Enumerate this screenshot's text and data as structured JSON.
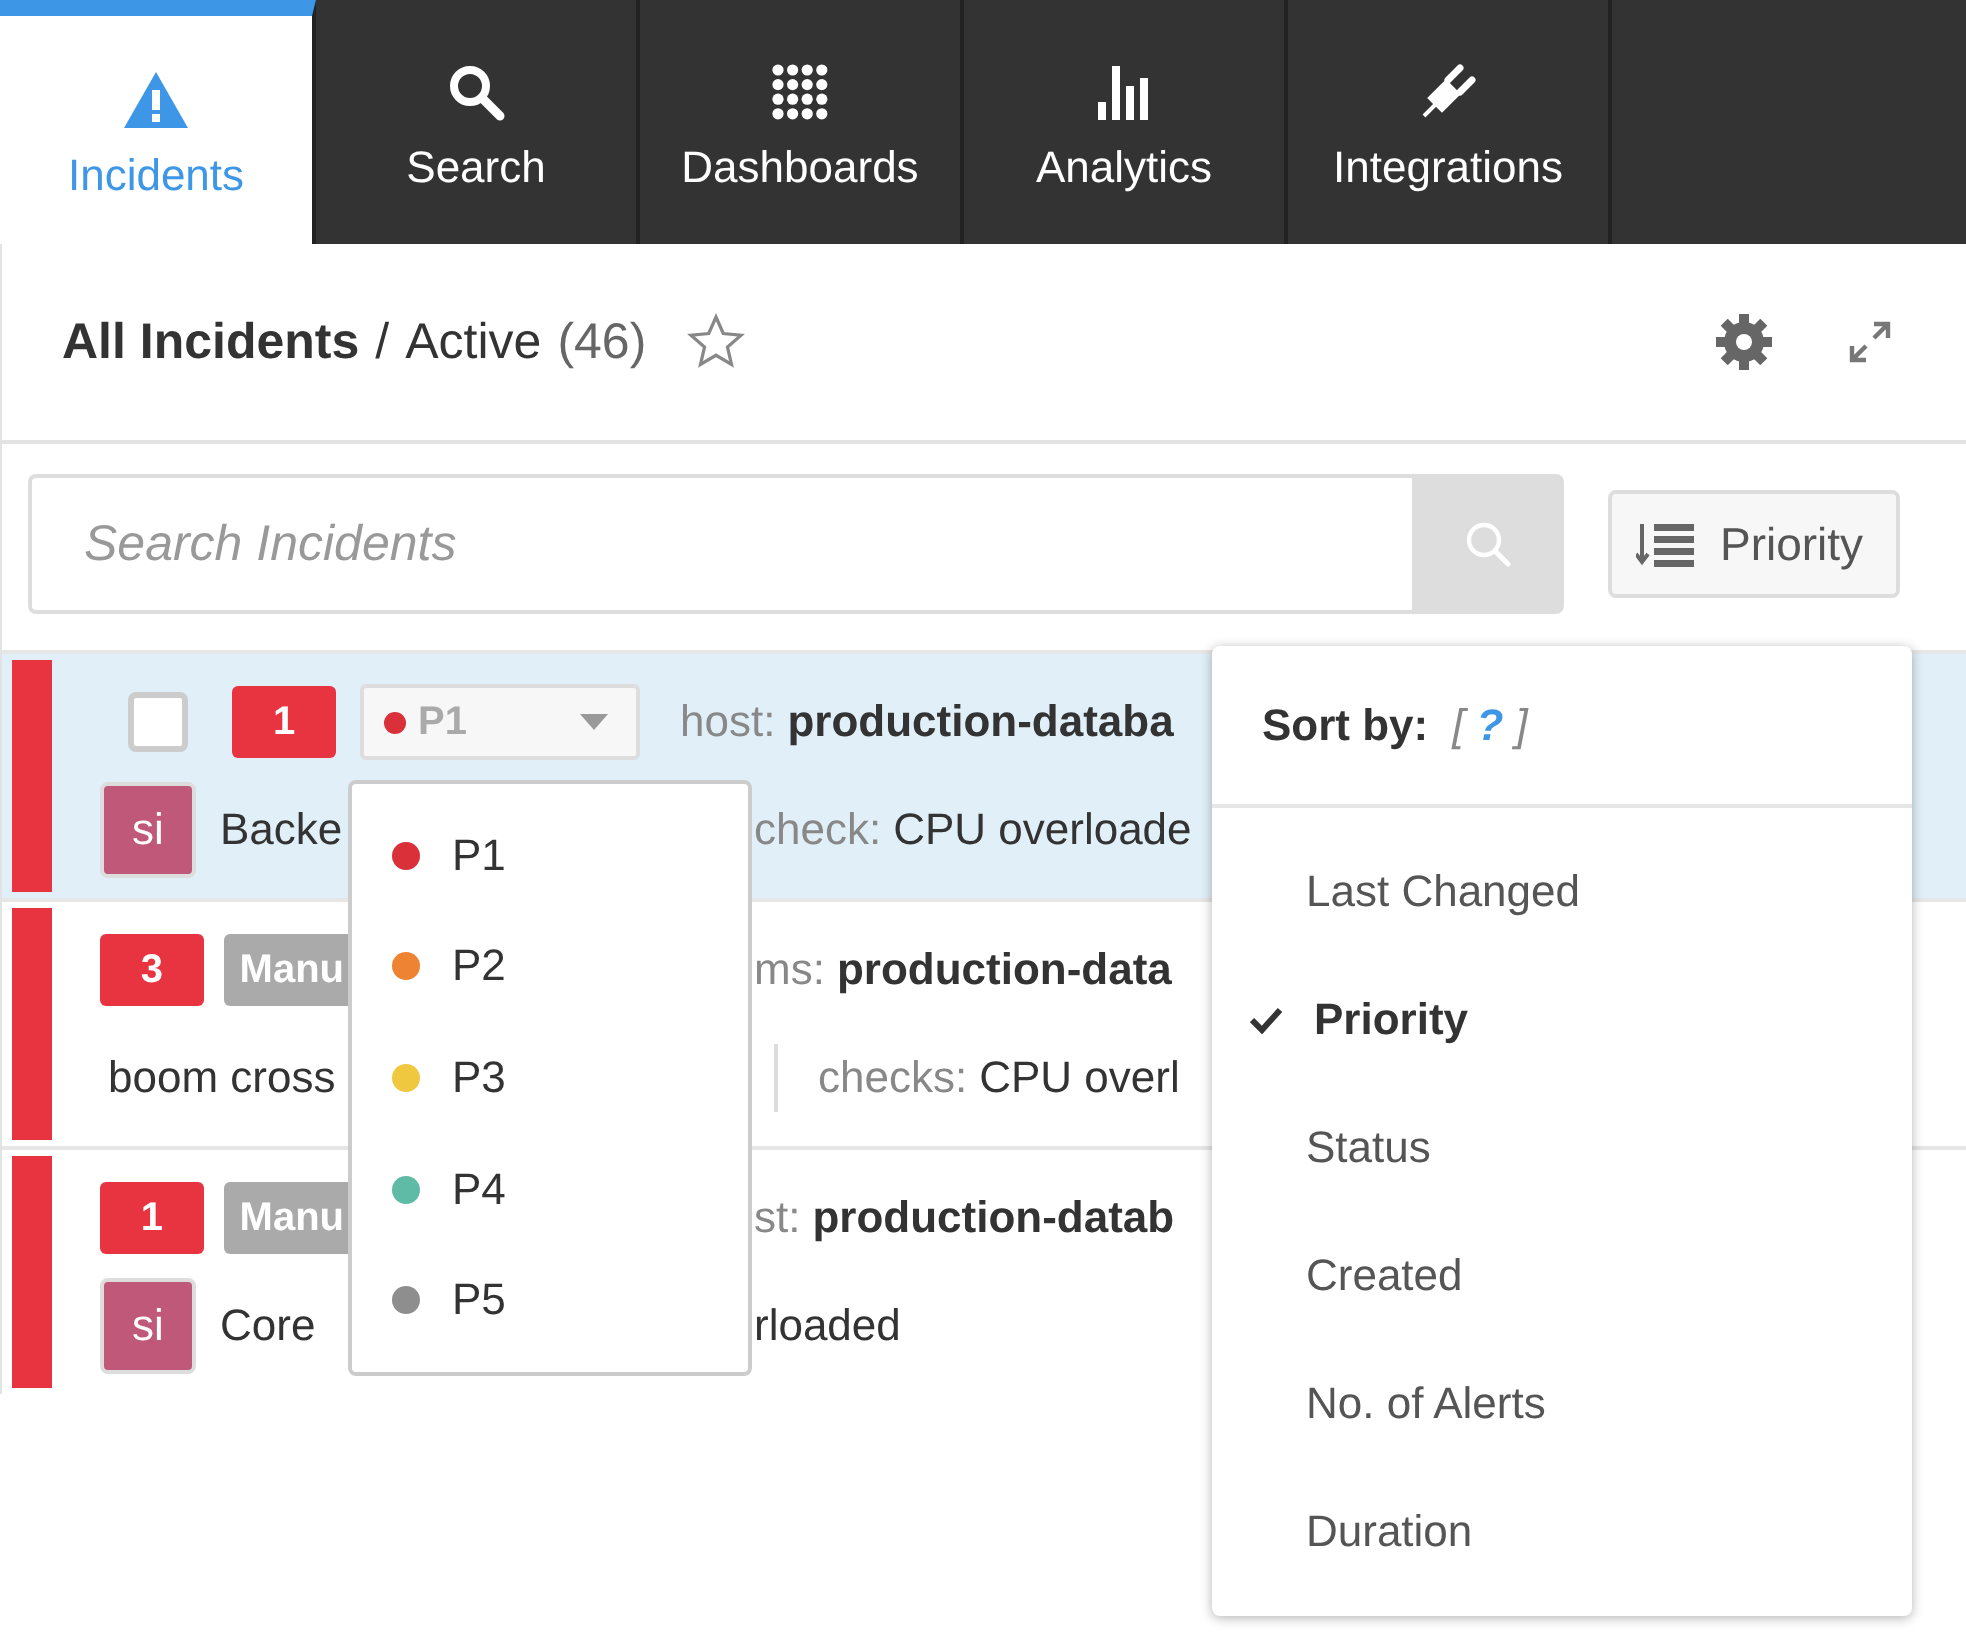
{
  "tabs": [
    {
      "label": "Incidents",
      "selected": true
    },
    {
      "label": "Search",
      "selected": false
    },
    {
      "label": "Dashboards",
      "selected": false
    },
    {
      "label": "Analytics",
      "selected": false
    },
    {
      "label": "Integrations",
      "selected": false
    }
  ],
  "header": {
    "title": "All Incidents",
    "separator": "/",
    "view": "Active",
    "count": "(46)",
    "starred": false
  },
  "search": {
    "placeholder": "Search Incidents"
  },
  "sort_button": {
    "label": "Priority"
  },
  "incidents": [
    {
      "selected": true,
      "checked": false,
      "count": "1",
      "priority_select": {
        "label": "P1",
        "color": "#d9303a"
      },
      "meta_key": "host:",
      "meta_value": "production-databa",
      "avatar": "si",
      "title": "Backe",
      "detail_key": "check:",
      "detail_value": "CPU overloade",
      "divider": false
    },
    {
      "selected": false,
      "count": "3",
      "tag": "Manu",
      "meta_key": "ms:",
      "meta_value": "production-data",
      "title": "boom cross",
      "detail_key": "checks:",
      "detail_value": "CPU overl",
      "divider": true
    },
    {
      "selected": false,
      "count": "1",
      "tag": "Manu",
      "meta_key": "st:",
      "meta_value": "production-datab",
      "avatar": "si",
      "title": "Core",
      "detail_value": "rloaded",
      "divider": false
    }
  ],
  "priority_menu": [
    {
      "label": "P1",
      "color": "#d9303a"
    },
    {
      "label": "P2",
      "color": "#ee8433"
    },
    {
      "label": "P3",
      "color": "#f0c840"
    },
    {
      "label": "P4",
      "color": "#5fbba6"
    },
    {
      "label": "P5",
      "color": "#8e8e8e"
    }
  ],
  "sort_menu": {
    "title": "Sort by:",
    "help_open": "[",
    "help": "?",
    "help_close": "]",
    "options": [
      {
        "label": "Last Changed",
        "selected": false
      },
      {
        "label": "Priority",
        "selected": true
      },
      {
        "label": "Status",
        "selected": false
      },
      {
        "label": "Created",
        "selected": false
      },
      {
        "label": "No. of Alerts",
        "selected": false
      },
      {
        "label": "Duration",
        "selected": false
      }
    ]
  }
}
